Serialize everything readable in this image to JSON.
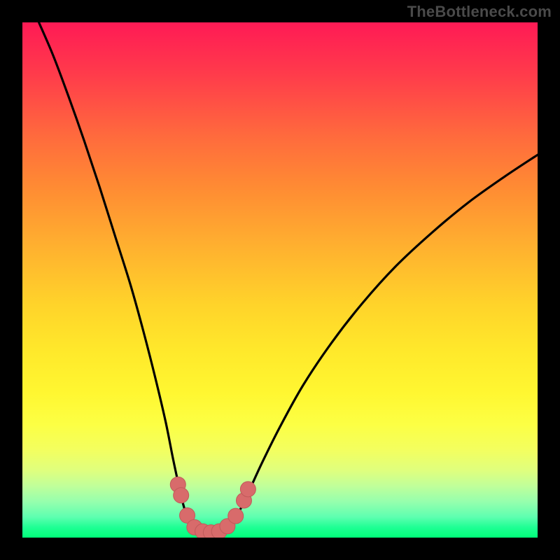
{
  "watermark": "TheBottleneck.com",
  "palette": {
    "frame": "#000000",
    "curve": "#000000",
    "marker_fill": "#d86b6b",
    "marker_stroke": "#c05a5a"
  },
  "chart_data": {
    "type": "line",
    "title": "",
    "xlabel": "",
    "ylabel": "",
    "xlim": [
      0,
      1
    ],
    "ylim": [
      0,
      1
    ],
    "grid": false,
    "legend": false,
    "description": "V-shaped bottleneck curve over a vertical rainbow gradient (red at top → green at bottom). Values are normalized plot coordinates, y=0 at bottom.",
    "curve_points": [
      {
        "x": 0.032,
        "y": 1.0
      },
      {
        "x": 0.06,
        "y": 0.935
      },
      {
        "x": 0.09,
        "y": 0.855
      },
      {
        "x": 0.12,
        "y": 0.77
      },
      {
        "x": 0.15,
        "y": 0.68
      },
      {
        "x": 0.18,
        "y": 0.585
      },
      {
        "x": 0.21,
        "y": 0.49
      },
      {
        "x": 0.235,
        "y": 0.4
      },
      {
        "x": 0.258,
        "y": 0.31
      },
      {
        "x": 0.278,
        "y": 0.225
      },
      {
        "x": 0.293,
        "y": 0.15
      },
      {
        "x": 0.305,
        "y": 0.095
      },
      {
        "x": 0.315,
        "y": 0.055
      },
      {
        "x": 0.328,
        "y": 0.028
      },
      {
        "x": 0.345,
        "y": 0.013
      },
      {
        "x": 0.365,
        "y": 0.01
      },
      {
        "x": 0.385,
        "y": 0.013
      },
      {
        "x": 0.405,
        "y": 0.028
      },
      {
        "x": 0.423,
        "y": 0.055
      },
      {
        "x": 0.442,
        "y": 0.095
      },
      {
        "x": 0.465,
        "y": 0.145
      },
      {
        "x": 0.5,
        "y": 0.215
      },
      {
        "x": 0.545,
        "y": 0.296
      },
      {
        "x": 0.6,
        "y": 0.378
      },
      {
        "x": 0.66,
        "y": 0.455
      },
      {
        "x": 0.725,
        "y": 0.527
      },
      {
        "x": 0.795,
        "y": 0.592
      },
      {
        "x": 0.865,
        "y": 0.65
      },
      {
        "x": 0.935,
        "y": 0.7
      },
      {
        "x": 1.0,
        "y": 0.743
      }
    ],
    "markers": [
      {
        "x": 0.302,
        "y": 0.103
      },
      {
        "x": 0.308,
        "y": 0.082
      },
      {
        "x": 0.32,
        "y": 0.043
      },
      {
        "x": 0.334,
        "y": 0.02
      },
      {
        "x": 0.35,
        "y": 0.012
      },
      {
        "x": 0.366,
        "y": 0.01
      },
      {
        "x": 0.382,
        "y": 0.012
      },
      {
        "x": 0.398,
        "y": 0.022
      },
      {
        "x": 0.414,
        "y": 0.042
      },
      {
        "x": 0.43,
        "y": 0.072
      },
      {
        "x": 0.438,
        "y": 0.094
      }
    ],
    "marker_radius_px": 11
  }
}
